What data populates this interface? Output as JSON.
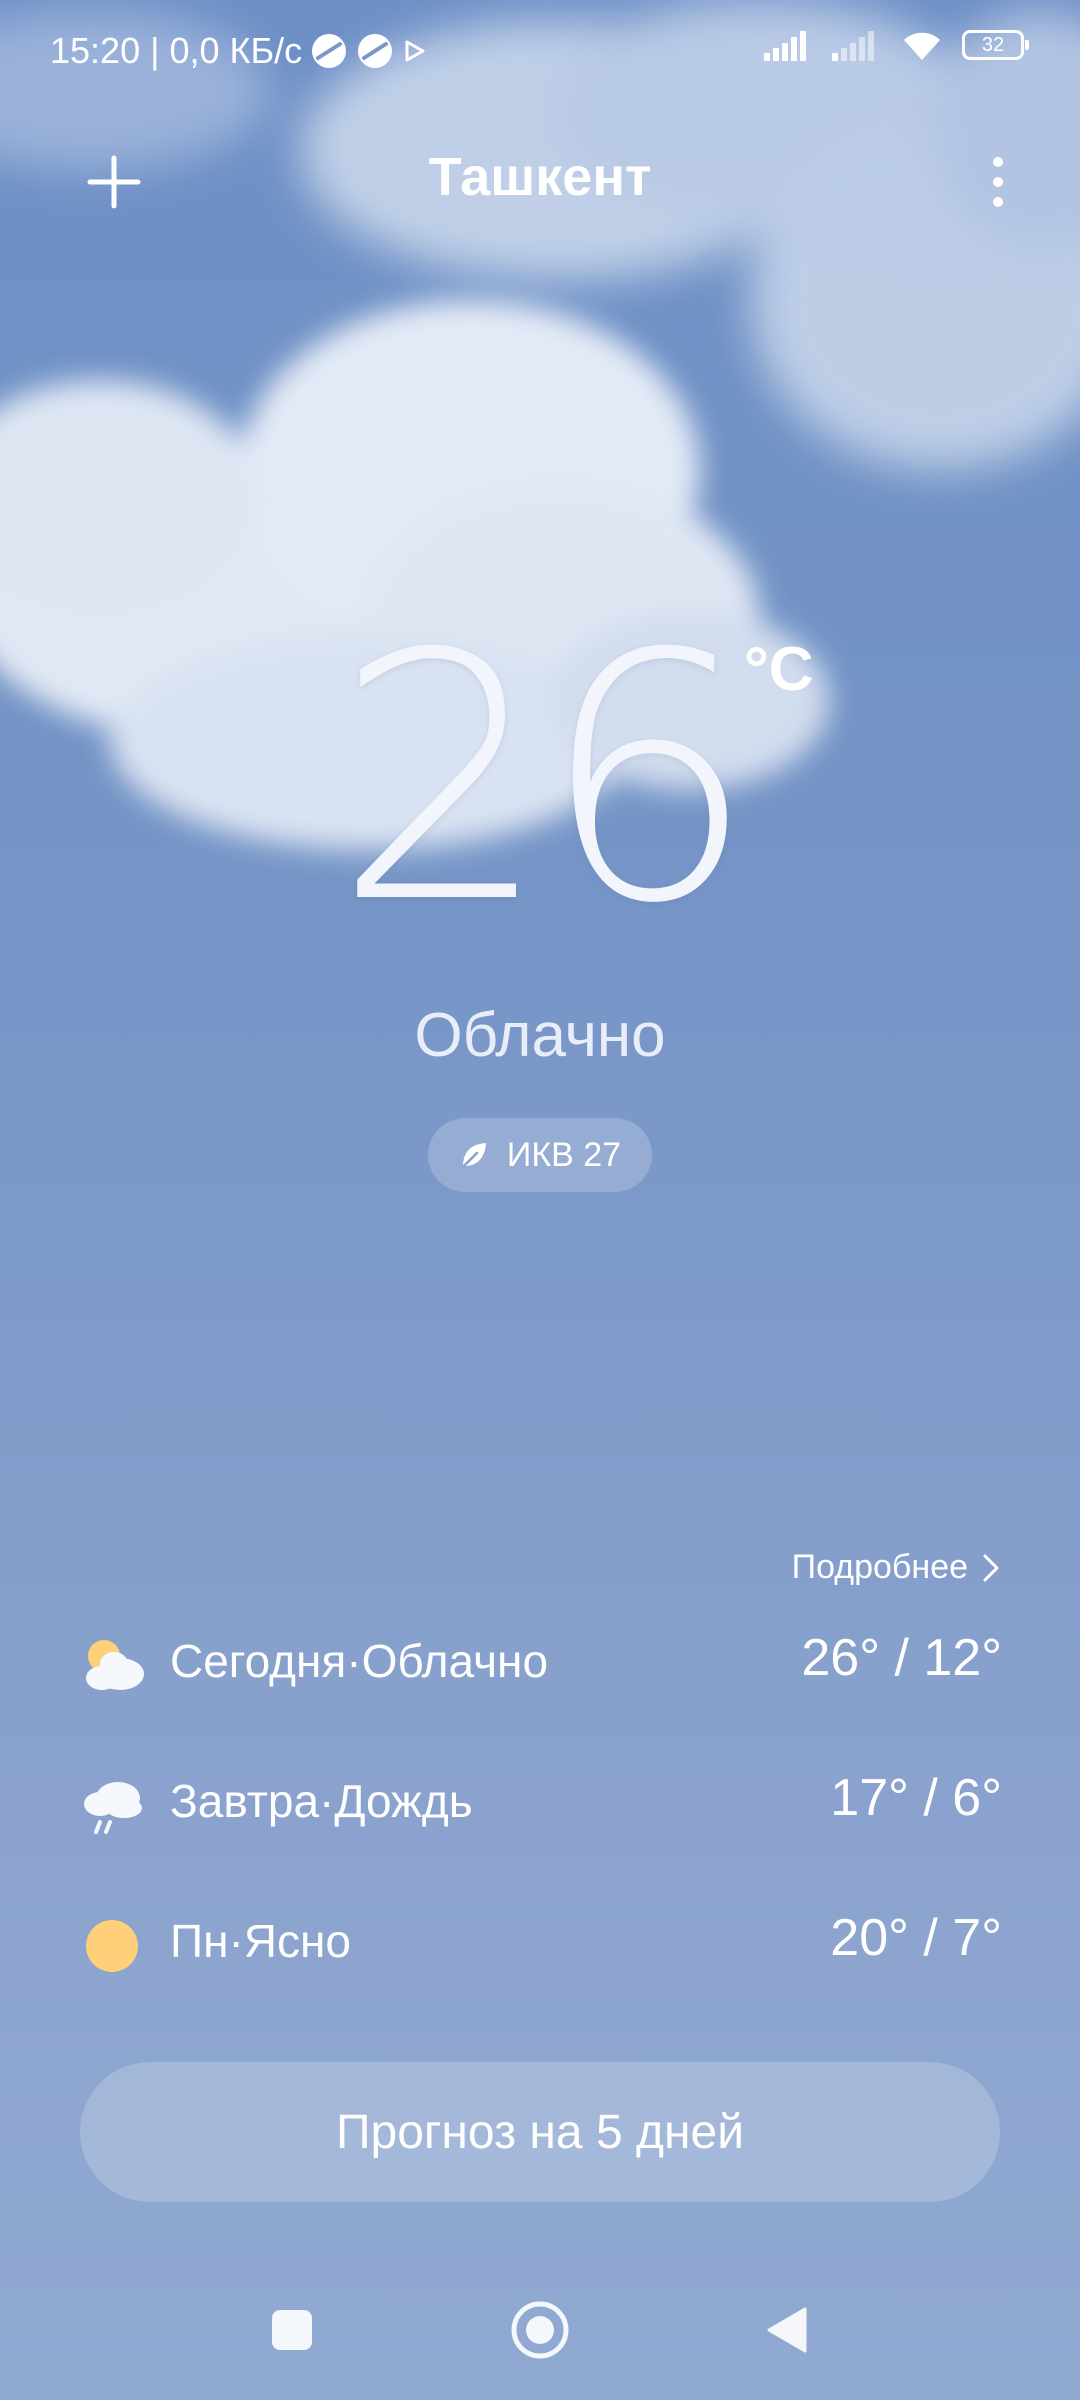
{
  "status_bar": {
    "time_network": "15:20 | 0,0 КБ/с",
    "battery": "32"
  },
  "header": {
    "city": "Ташкент"
  },
  "current": {
    "temperature": "26",
    "unit": "°C",
    "condition": "Облачно",
    "aqi_label": "ИКВ 27"
  },
  "forecast": {
    "more_label": "Подробнее",
    "days": [
      {
        "label": "Сегодня·Облачно",
        "temp": "26° / 12°",
        "icon": "partly-cloudy-icon"
      },
      {
        "label": "Завтра·Дождь",
        "temp": "17° / 6°",
        "icon": "rain-icon"
      },
      {
        "label": "Пн·Ясно",
        "temp": "20° / 7°",
        "icon": "sun-icon"
      }
    ],
    "button_label": "Прогноз на 5 дней"
  },
  "colors": {
    "sky_top": "#6d8fc6",
    "sky_bottom": "#91aad2",
    "sun": "#ffd07a"
  }
}
